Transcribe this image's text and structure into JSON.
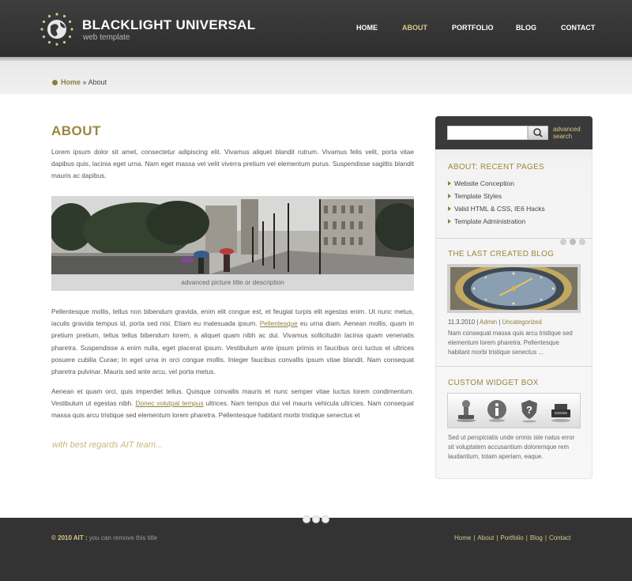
{
  "header": {
    "logo_title": "BLACKLIGHT UNIVERSAL",
    "logo_sub": "web template",
    "nav": [
      {
        "label": "HOME"
      },
      {
        "label": "ABOUT"
      },
      {
        "label": "PORTFOLIO"
      },
      {
        "label": "BLOG"
      },
      {
        "label": "CONTACT"
      }
    ],
    "active_nav": "ABOUT"
  },
  "breadcrumb": {
    "home": "Home",
    "separator": "»",
    "current": "About"
  },
  "main": {
    "title": "ABOUT",
    "intro": "Lorem ipsum dolor sit amet, consectetur adipiscing elit. Vivamus aliquet blandit rutrum. Vivamus felis velit, porta vitae dapibus quis, lacinia eget urna. Nam eget massa vel velit viverra pretium vel elementum purus. Suspendisse sagittis blandit mauris ac dapibus.",
    "picture_caption": "advanced picture title or description",
    "para2_a": "Pellentesque mollis, tellus non bibendum gravida, enim elit congue est, et feugiat turpis elit egestas enim. Ut nunc metus, iaculis gravida tempus id, porta sed nisi. Etiam eu malesuada ipsum. ",
    "para2_link": "Pellentesque",
    "para2_b": " eu urna diam. Aenean mollis, quam in pretium pretium, tellus tellus bibendum lorem, a aliquet quam nibh ac dui. Vivamus sollicitudin lacinia quam venenatis pharetra. Suspendisse a enim nulla, eget placerat ipsum. Vestibulum ante ipsum primis in faucibus orci luctus et ultrices posuere cubilia Curae; In eget urna in orci congue mollis. Integer faucibus convallis ipsum vitae blandit. Nam consequat pharetra pulvinar. Mauris sed ante arcu, vel porta metus.",
    "para3_a": "Aenean et quam orci, quis imperdiet tellus. Quisque convallis mauris et nunc semper vitae luctus lorem condimentum. Vestibulum ut egestas nibh. ",
    "para3_link": "Donec volutpat tempus",
    "para3_b": " ultrices. Nam tempus dui vel mauris vehicula ultricies. Nam consequat massa quis arcu tristique sed elementum lorem pharetra. Pellentesque habitant morbi tristique senectus et",
    "signature": "with best regards AIT team..."
  },
  "sidebar": {
    "search_placeholder": "",
    "advanced_search": "advanced search",
    "recent_title": "ABOUT: RECENT PAGES",
    "recent_pages": [
      "Website Conception",
      "Template Styles",
      "Valid HTML & CSS, IE6 Hacks",
      "Template Administration"
    ],
    "blog_title": "THE LAST CREATED BLOG",
    "blog_date": "11.3.2010",
    "blog_author": "Admin",
    "blog_category": "Uncategorized",
    "blog_excerpt": "Nam consequat massa quis arcu tristique sed elementum lorem pharetra. Pellentesque habitant morbi tristique senectus ...",
    "widget_title": "CUSTOM WIDGET BOX",
    "widget_icons": [
      "stamp-icon",
      "info-icon",
      "help-shield-icon",
      "fax-icon"
    ],
    "widget_text": "Sed ut perspiciatis unde omnis iste natus error sit voluptatem accusantium doloremque rem laudantium, totam aperiam, eaque."
  },
  "footer": {
    "copyright_bold": "© 2010 AIT :",
    "copyright_text": "you can remove this title",
    "links": [
      "Home",
      "About",
      "Portfolio",
      "Blog",
      "Contact"
    ]
  },
  "colors": {
    "accent_gold": "#9a8640",
    "header_dark": "#333333",
    "nav_active": "#d7c98a"
  }
}
